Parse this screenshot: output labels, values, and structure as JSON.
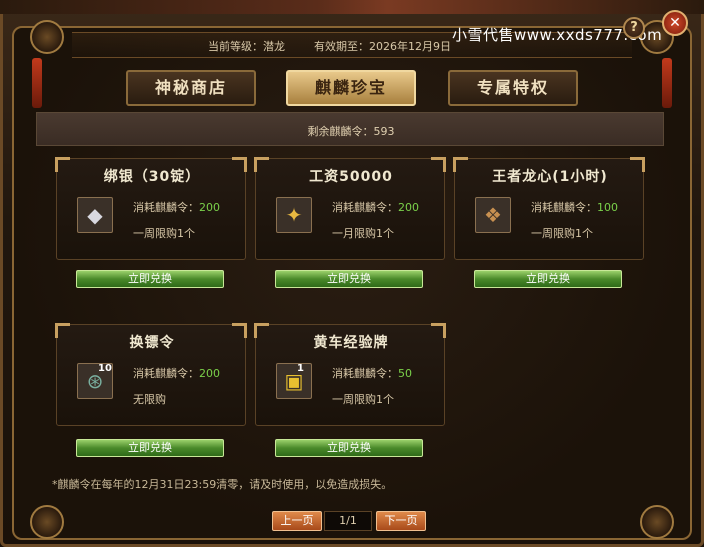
{
  "header": {
    "level_text": "当前等级：潜龙",
    "expire_text": "有效期至：2026年12月9日",
    "watermark": "小雪代售www.xxds777.com",
    "help_label": "?",
    "close_label": "✕"
  },
  "tabs": [
    {
      "label": "神秘商店",
      "active": false
    },
    {
      "label": "麒麟珍宝",
      "active": true
    },
    {
      "label": "专属特权",
      "active": false
    }
  ],
  "remaining": "剩余麒麟令：593",
  "items": [
    {
      "title": "绑银（30锭）",
      "cost_label": "消耗麒麟令：",
      "cost": "200",
      "limit": "一周限购1个",
      "icon": "silver-ingot-icon",
      "glyph": "◆",
      "badge": "",
      "button": "立即兑换"
    },
    {
      "title": "工资50000",
      "cost_label": "消耗麒麟令：",
      "cost": "200",
      "limit": "一月限购1个",
      "icon": "gold-treasure-icon",
      "glyph": "✦",
      "badge": "",
      "button": "立即兑换"
    },
    {
      "title": "王者龙心(1小时)",
      "cost_label": "消耗麒麟令：",
      "cost": "100",
      "limit": "一周限购1个",
      "icon": "dragon-heart-icon",
      "glyph": "❖",
      "badge": "",
      "button": "立即兑换"
    },
    {
      "title": "换镖令",
      "cost_label": "消耗麒麟令：",
      "cost": "200",
      "limit": "无限购",
      "icon": "escort-token-icon",
      "glyph": "⊛",
      "badge": "10",
      "button": "立即兑换"
    },
    {
      "title": "黄车经验牌",
      "cost_label": "消耗麒麟令：",
      "cost": "50",
      "limit": "一周限购1个",
      "icon": "yellow-cart-exp-icon",
      "glyph": "▣",
      "badge": "1",
      "button": "立即兑换"
    }
  ],
  "footnote": "*麒麟令在每年的12月31日23:59清零，请及时使用，以免造成损失。",
  "pager": {
    "prev": "上一页",
    "page": "1/1",
    "next": "下一页"
  },
  "colors": {
    "accent_gold": "#c8a060",
    "cost_green": "#7ad04a",
    "button_green": "#4a8a2a",
    "pager_orange": "#c8622a"
  }
}
